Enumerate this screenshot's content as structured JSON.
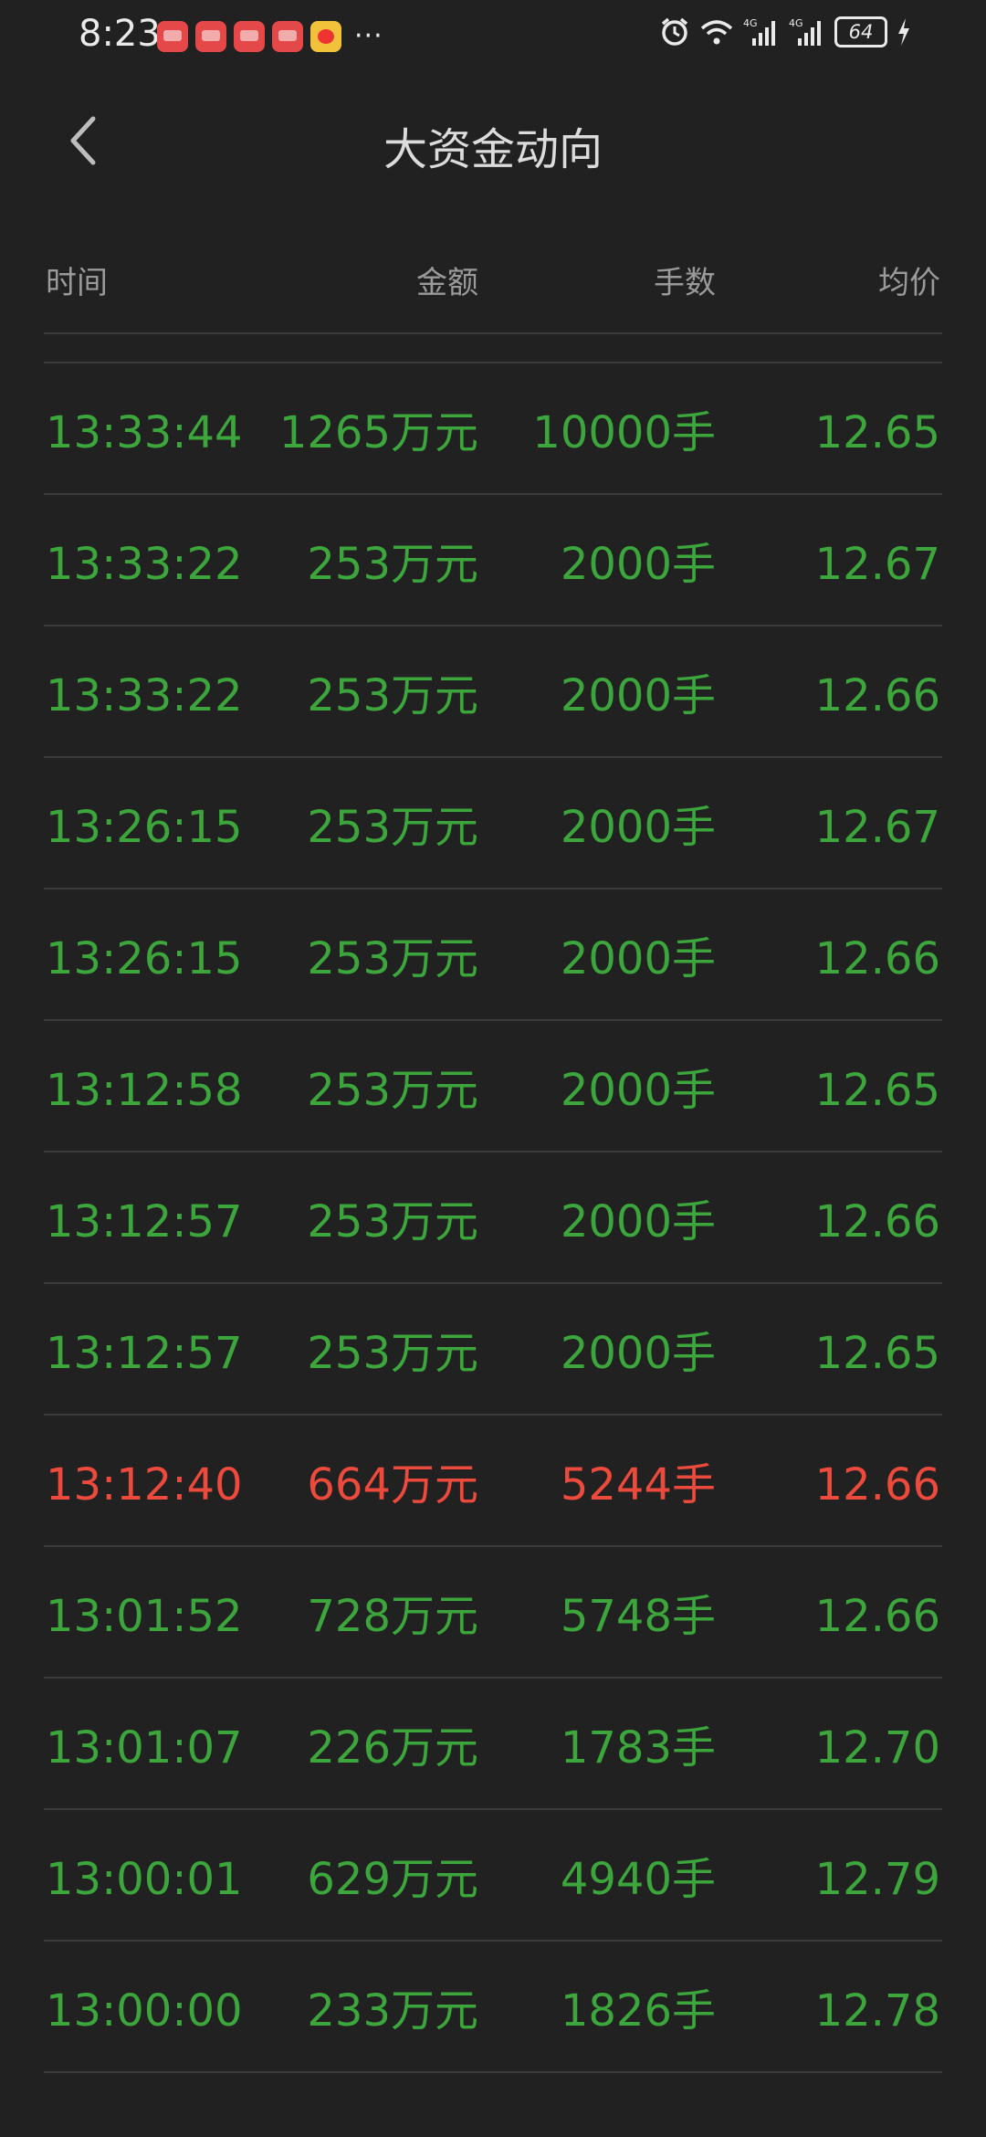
{
  "status_bar": {
    "time": "8:23",
    "more": "···",
    "battery": "64",
    "network": "4G"
  },
  "header": {
    "title": "大资金动向"
  },
  "columns": {
    "time": "时间",
    "amount": "金额",
    "quantity": "手数",
    "price": "均价"
  },
  "colors": {
    "buy": "#3ca63c",
    "sell": "#ec4a3c",
    "background": "#212121"
  },
  "rows": [
    {
      "time": "13:33:44",
      "amount": "1265万元",
      "quantity": "10000手",
      "price": "12.65",
      "side": "green"
    },
    {
      "time": "13:33:22",
      "amount": "253万元",
      "quantity": "2000手",
      "price": "12.67",
      "side": "green"
    },
    {
      "time": "13:33:22",
      "amount": "253万元",
      "quantity": "2000手",
      "price": "12.66",
      "side": "green"
    },
    {
      "time": "13:26:15",
      "amount": "253万元",
      "quantity": "2000手",
      "price": "12.67",
      "side": "green"
    },
    {
      "time": "13:26:15",
      "amount": "253万元",
      "quantity": "2000手",
      "price": "12.66",
      "side": "green"
    },
    {
      "time": "13:12:58",
      "amount": "253万元",
      "quantity": "2000手",
      "price": "12.65",
      "side": "green"
    },
    {
      "time": "13:12:57",
      "amount": "253万元",
      "quantity": "2000手",
      "price": "12.66",
      "side": "green"
    },
    {
      "time": "13:12:57",
      "amount": "253万元",
      "quantity": "2000手",
      "price": "12.65",
      "side": "green"
    },
    {
      "time": "13:12:40",
      "amount": "664万元",
      "quantity": "5244手",
      "price": "12.66",
      "side": "red"
    },
    {
      "time": "13:01:52",
      "amount": "728万元",
      "quantity": "5748手",
      "price": "12.66",
      "side": "green"
    },
    {
      "time": "13:01:07",
      "amount": "226万元",
      "quantity": "1783手",
      "price": "12.70",
      "side": "green"
    },
    {
      "time": "13:00:01",
      "amount": "629万元",
      "quantity": "4940手",
      "price": "12.79",
      "side": "green"
    },
    {
      "time": "13:00:00",
      "amount": "233万元",
      "quantity": "1826手",
      "price": "12.78",
      "side": "green"
    }
  ]
}
